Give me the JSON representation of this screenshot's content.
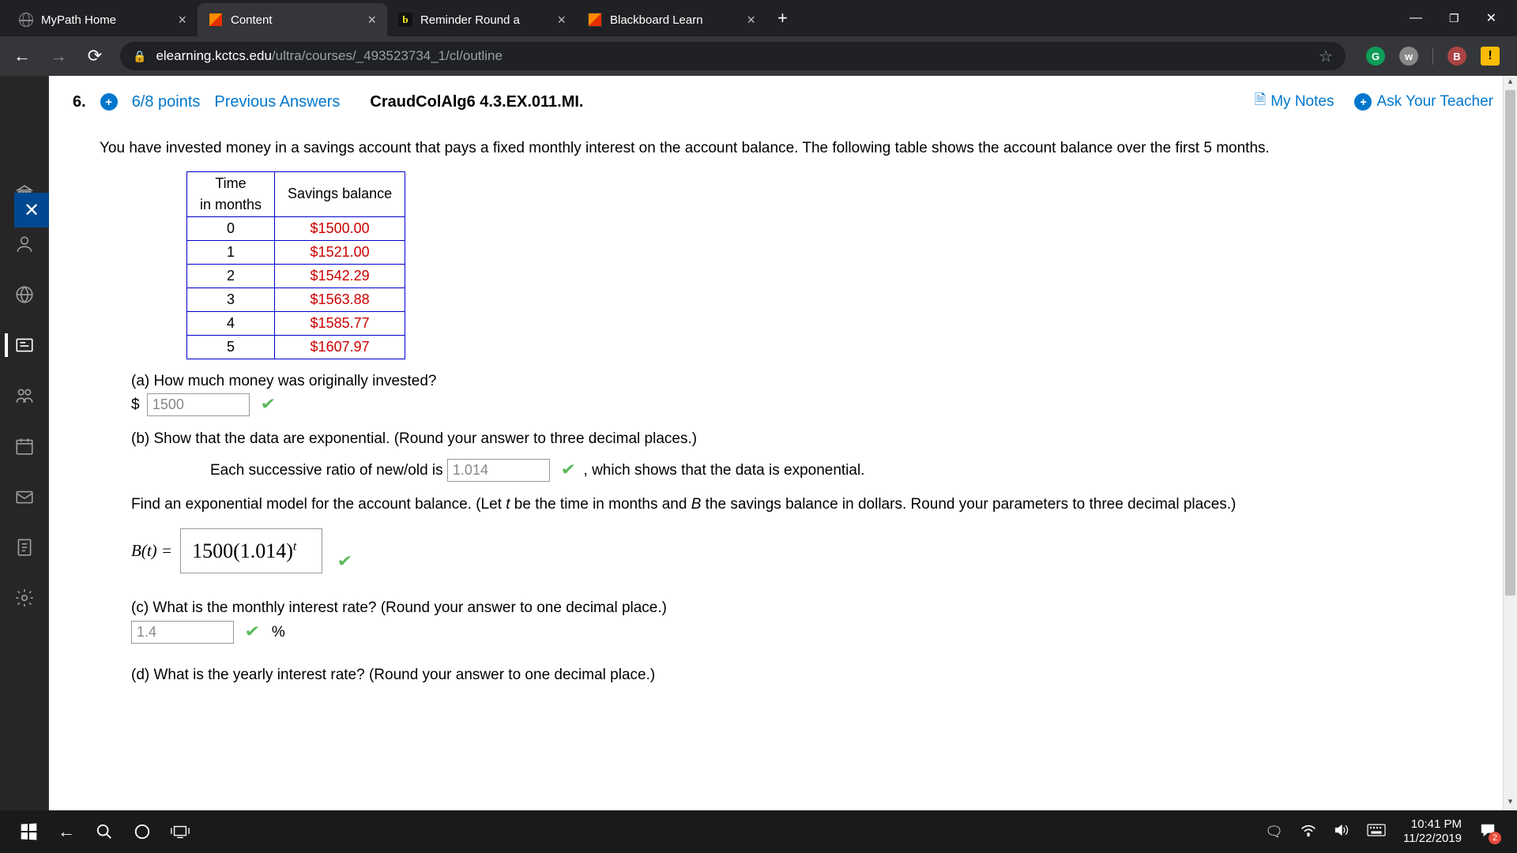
{
  "tabs": [
    {
      "label": "MyPath Home"
    },
    {
      "label": "Content"
    },
    {
      "label": "Reminder Round a"
    },
    {
      "label": "Blackboard Learn"
    }
  ],
  "url": {
    "domain": "elearning.kctcs.edu",
    "path": "/ultra/courses/_493523734_1/cl/outline"
  },
  "question": {
    "number": "6.",
    "points": "6/8 points",
    "prev_answers": "Previous Answers",
    "exercise_id": "CraudColAlg6 4.3.EX.011.MI.",
    "my_notes": "My Notes",
    "ask_teacher": "Ask Your Teacher",
    "intro": "You have invested money in a savings account that pays a fixed monthly interest on the account balance. The following table shows the account balance over the first 5 months.",
    "table_headers": {
      "time_l1": "Time",
      "time_l2": "in months",
      "balance": "Savings balance"
    },
    "table_rows": [
      {
        "month": "0",
        "balance": "$1500.00"
      },
      {
        "month": "1",
        "balance": "$1521.00"
      },
      {
        "month": "2",
        "balance": "$1542.29"
      },
      {
        "month": "3",
        "balance": "$1563.88"
      },
      {
        "month": "4",
        "balance": "$1585.77"
      },
      {
        "month": "5",
        "balance": "$1607.97"
      }
    ],
    "part_a": {
      "prompt": "(a) How much money was originally invested?",
      "prefix": "$",
      "value": "1500"
    },
    "part_b": {
      "prompt": "(b) Show that the data are exponential. (Round your answer to three decimal places.)",
      "sub_prefix": "Each successive ratio of new/old is",
      "value": "1.014",
      "sub_suffix": ", which shows that the data is exponential.",
      "model_text": "Find an exponential model for the account balance. (Let t be the time in months and B the savings balance in dollars. Round your parameters to three decimal places.)",
      "model_label": "B(t) =",
      "model_base": "1500(1.014)",
      "model_exp": "t"
    },
    "part_c": {
      "prompt": "(c) What is the monthly interest rate? (Round your answer to one decimal place.)",
      "value": "1.4",
      "unit": "%"
    },
    "part_d": {
      "prompt": "(d) What is the yearly interest rate? (Round your answer to one decimal place.)"
    }
  },
  "clock": {
    "time": "10:41 PM",
    "date": "11/22/2019"
  }
}
